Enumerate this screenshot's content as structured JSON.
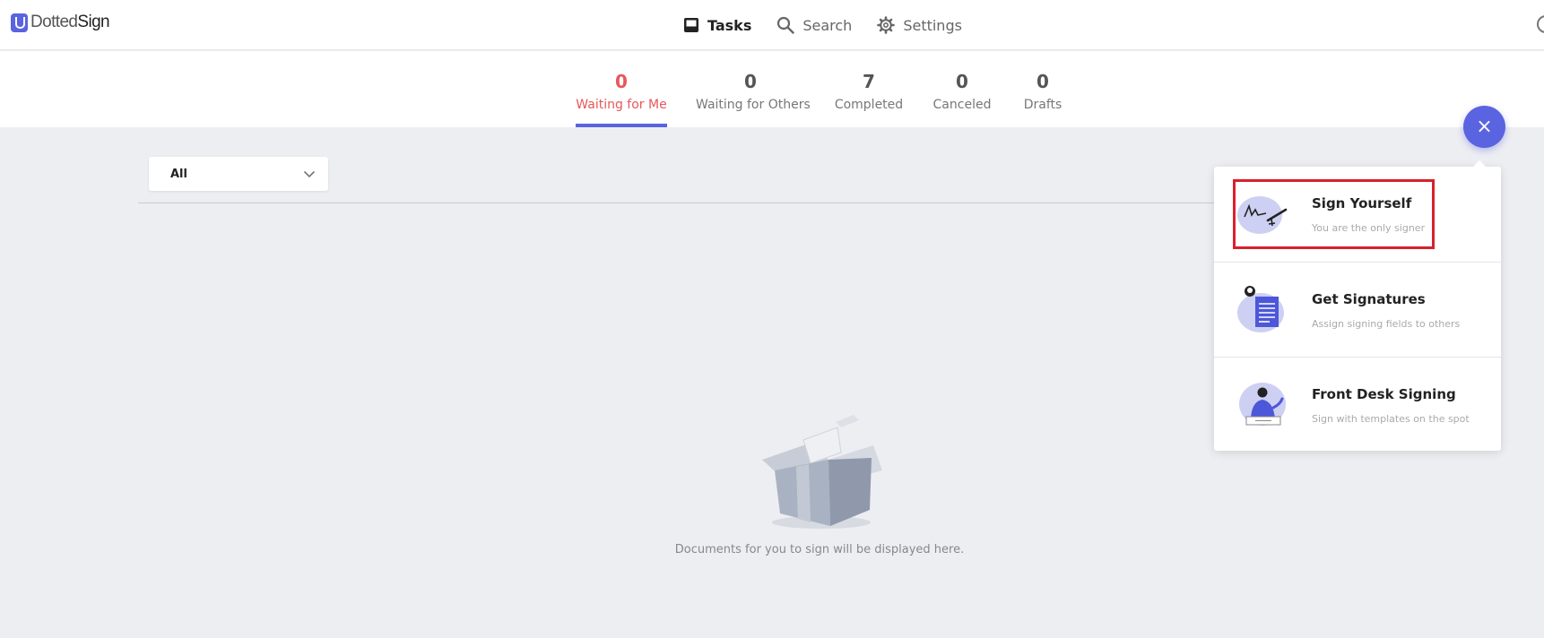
{
  "app": {
    "logo": {
      "text_light": "Dotted",
      "text_bold": "Sign"
    }
  },
  "nav": {
    "tasks": {
      "label": "Tasks",
      "icon": "inbox-icon"
    },
    "search": {
      "label": "Search",
      "icon": "search-icon"
    },
    "settings": {
      "label": "Settings",
      "icon": "gear-icon"
    }
  },
  "tabs": [
    {
      "count": "0",
      "label": "Waiting for Me",
      "active": true
    },
    {
      "count": "0",
      "label": "Waiting for Others"
    },
    {
      "count": "7",
      "label": "Completed"
    },
    {
      "count": "0",
      "label": "Canceled"
    },
    {
      "count": "0",
      "label": "Drafts"
    }
  ],
  "filter": {
    "value": "All"
  },
  "empty_state": {
    "text": "Documents for you to sign will be displayed here."
  },
  "fab": {
    "label": "×"
  },
  "menu": [
    {
      "title": "Sign Yourself",
      "description": "You are the only signer",
      "highlighted": true
    },
    {
      "title": "Get Signatures",
      "description": "Assign signing fields to others"
    },
    {
      "title": "Front Desk Signing",
      "description": "Sign with templates on the spot"
    }
  ],
  "colors": {
    "accent": "#5a63e0",
    "active_tab_text": "#e8575a",
    "highlight": "#d8212c",
    "background": "#edeef2"
  }
}
